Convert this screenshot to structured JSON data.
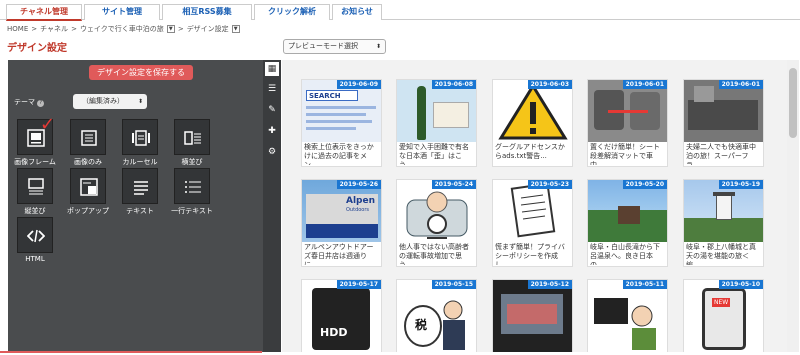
{
  "tabs": [
    {
      "label": "チャネル管理",
      "active": true
    },
    {
      "label": "サイト管理"
    },
    {
      "label": "相互RSS募集"
    },
    {
      "label": "クリック解析"
    },
    {
      "label": "お知らせ"
    }
  ],
  "breadcrumb": {
    "home": "HOME",
    "sep": ">",
    "channel": "チャネル",
    "blog": "ウェイクで行く車中泊の旅",
    "design": "デザイン設定"
  },
  "page_title": "デザイン設定",
  "preview_select": {
    "value": "プレビューモード選択"
  },
  "panel": {
    "save_label": "デザイン設定を保存する",
    "theme_label": "テーマ",
    "theme_value": "（編集済み）",
    "options": [
      {
        "label": "画像フレーム",
        "selected": true
      },
      {
        "label": "画像のみ"
      },
      {
        "label": "カルーセル"
      },
      {
        "label": "横並び"
      },
      {
        "label": "縦並び"
      },
      {
        "label": "ポップアップ"
      },
      {
        "label": "テキスト"
      },
      {
        "label": "一行テキスト"
      },
      {
        "label": "HTML"
      }
    ]
  },
  "side_icons": [
    "grid-icon",
    "sliders-icon",
    "brush-icon",
    "puzzle-icon",
    "gear-icon"
  ],
  "cards": [
    {
      "date": "2019-06-09",
      "text": "検索上位表示をきっかけに過去の記事をメン..."
    },
    {
      "date": "2019-06-08",
      "text": "愛知で入手困難で有名な日本酒「歪」はこう..."
    },
    {
      "date": "2019-06-03",
      "text": "グーグルアドセンスからads.txt警告..."
    },
    {
      "date": "2019-06-01",
      "text": "置くだけ簡単！シート段差解消マットで車中..."
    },
    {
      "date": "2019-06-01",
      "text": "夫婦二人でも快適車中泊の旅！スーパーフラ..."
    },
    {
      "date": "2019-05-26",
      "text": "アルペンアウトドアーズ春日井店は週通りに..."
    },
    {
      "date": "2019-05-24",
      "text": "他人事ではない高齢者の運転事故増加で思う..."
    },
    {
      "date": "2019-05-23",
      "text": "慌まず簡単！プライバシーポリシーを作成し..."
    },
    {
      "date": "2019-05-20",
      "text": "岐阜・白山長滝から下呂温泉へ。良き日本の..."
    },
    {
      "date": "2019-05-19",
      "text": "岐阜・郡上八幡城と真天の湯を堪能の旅＜編..."
    },
    {
      "date": "2019-05-17",
      "text": ""
    },
    {
      "date": "2019-05-15",
      "text": ""
    },
    {
      "date": "2019-05-12",
      "text": ""
    },
    {
      "date": "2019-05-11",
      "text": ""
    },
    {
      "date": "2019-05-10",
      "text": ""
    }
  ],
  "thumb_labels": {
    "search": "SEARCH",
    "alpen": "Alpen",
    "alpen_sub": "Outdoors",
    "hdd": "HDD",
    "tax": "税",
    "news": "NEW"
  }
}
